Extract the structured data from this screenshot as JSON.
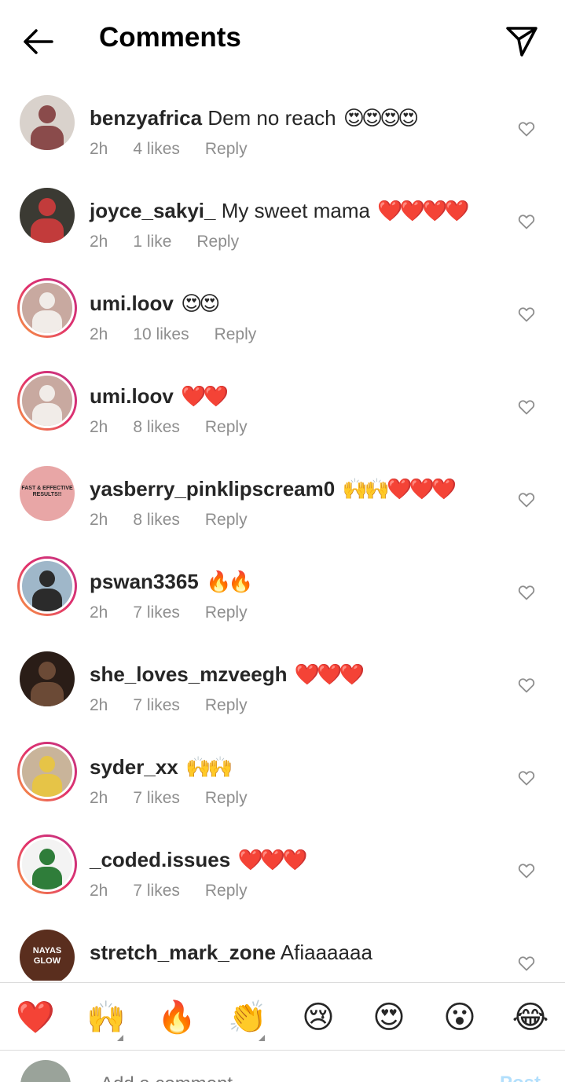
{
  "header": {
    "title": "Comments"
  },
  "comments": [
    {
      "username": "benzyafrica",
      "text": "Dem no reach",
      "emoji": "😍😍😍😍",
      "time": "2h",
      "likes": "4 likes",
      "reply": "Reply",
      "ring": false,
      "avatar_bg": "#d9d2cc",
      "avatar_fg": "#8a4b4b"
    },
    {
      "username": "joyce_sakyi_",
      "text": "My sweet mama",
      "emoji": "❤️❤️❤️❤️",
      "time": "2h",
      "likes": "1 like",
      "reply": "Reply",
      "ring": false,
      "avatar_bg": "#3b3a33",
      "avatar_fg": "#c23b3b"
    },
    {
      "username": "umi.loov",
      "text": "",
      "emoji": "😍😍",
      "time": "2h",
      "likes": "10 likes",
      "reply": "Reply",
      "ring": true,
      "avatar_bg": "#c8a9a0",
      "avatar_fg": "#f1ece8"
    },
    {
      "username": "umi.loov",
      "text": "",
      "emoji": "❤️❤️",
      "time": "2h",
      "likes": "8 likes",
      "reply": "Reply",
      "ring": true,
      "avatar_bg": "#c8a9a0",
      "avatar_fg": "#f1ece8"
    },
    {
      "username": "yasberry_pinklipscream0",
      "text": "",
      "emoji": "🙌🙌❤️❤️❤️",
      "time": "2h",
      "likes": "8 likes",
      "reply": "Reply",
      "ring": false,
      "avatar_bg": "#e8a6a6",
      "avatar_fg": "#b84a5c",
      "avatar_text": "FAST & EFFECTIVE RESULTS!!"
    },
    {
      "username": "pswan3365",
      "text": "",
      "emoji": "🔥🔥",
      "time": "2h",
      "likes": "7 likes",
      "reply": "Reply",
      "ring": true,
      "avatar_bg": "#9fb7c9",
      "avatar_fg": "#2b2b2b"
    },
    {
      "username": "she_loves_mzveegh",
      "text": "",
      "emoji": "❤️❤️❤️",
      "time": "2h",
      "likes": "7 likes",
      "reply": "Reply",
      "ring": false,
      "avatar_bg": "#2a1d17",
      "avatar_fg": "#6b4a36"
    },
    {
      "username": "syder_xx",
      "text": "",
      "emoji": "🙌🙌",
      "time": "2h",
      "likes": "7 likes",
      "reply": "Reply",
      "ring": true,
      "avatar_bg": "#c9b49a",
      "avatar_fg": "#e6c447"
    },
    {
      "username": "_coded.issues",
      "text": "",
      "emoji": "❤️❤️❤️",
      "time": "2h",
      "likes": "7 likes",
      "reply": "Reply",
      "ring": true,
      "avatar_bg": "#f3f3f3",
      "avatar_fg": "#2f7d3a"
    },
    {
      "username": "stretch_mark_zone",
      "text": "Afiaaaaaa",
      "emoji": "",
      "time": "",
      "likes": "",
      "reply": "",
      "ring": false,
      "avatar_bg": "#5a2e1e",
      "avatar_fg": "#c98a5a",
      "avatar_text": "NAYAS GLOW"
    }
  ],
  "emoji_bar": [
    "❤️",
    "🙌",
    "🔥",
    "👏",
    "😢",
    "😍",
    "😮",
    "😂"
  ],
  "composer": {
    "placeholder": "Add a comment...",
    "post_label": "Post"
  },
  "icons": {
    "back": "arrow-left-icon",
    "send": "paper-plane-icon",
    "like": "heart-outline-icon"
  }
}
